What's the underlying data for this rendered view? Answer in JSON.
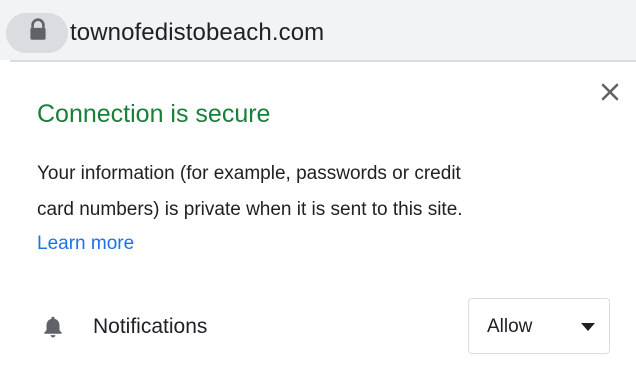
{
  "address_bar": {
    "url": "townofedistobeach.com",
    "security_icon": "lock-icon"
  },
  "site_info_popup": {
    "title": "Connection is secure",
    "title_color": "#188038",
    "description_line1": "Your information (for example, passwords or credit",
    "description_line2": "card numbers) is private when it is sent to this site.",
    "learn_more": "Learn more",
    "link_color": "#1a73e8",
    "close_icon": "close-icon",
    "permissions": [
      {
        "icon": "bell-icon",
        "label": "Notifications",
        "value": "Allow"
      }
    ]
  }
}
